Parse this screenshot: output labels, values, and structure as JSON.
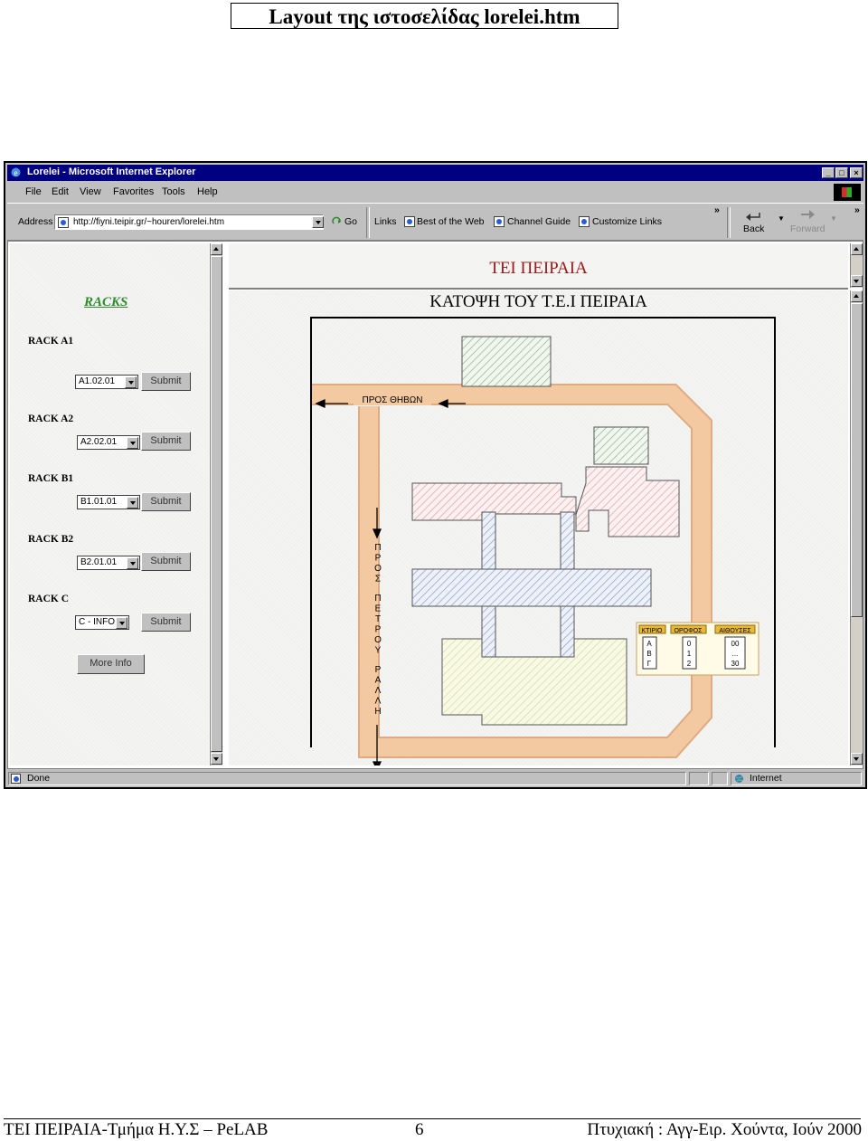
{
  "document": {
    "title": "Layout  της ιστοσελίδας  lorelei.htm",
    "footer": {
      "left": "ΤΕΙ ΠΕΙΡΑΙΑ-Τμήμα Η.Υ.Σ – PeLAB",
      "page": "6",
      "right": "Πτυχιακή : Αγγ-Ειρ. Χούντα, Ιούν 2000"
    }
  },
  "browser": {
    "window_title": "Lorelei - Microsoft Internet Explorer",
    "caption_buttons": [
      "_",
      "□",
      "×"
    ],
    "menu": [
      "File",
      "Edit",
      "View",
      "Favorites",
      "Tools",
      "Help"
    ],
    "address_label": "Address",
    "address_value": "http://fiyni.teipir.gr/~houren/lorelei.htm",
    "go_label": "Go",
    "links_label": "Links",
    "links": [
      "Best of the Web",
      "Channel Guide",
      "Customize Links"
    ],
    "chevron": "»",
    "back_label": "Back",
    "forward_label": "Forward",
    "status_text": "Done",
    "zone_text": "Internet"
  },
  "left_frame": {
    "heading": "RACKS",
    "racks": [
      {
        "label": "RACK A1",
        "select": "A1.02.01",
        "button": "Submit"
      },
      {
        "label": "RACK A2",
        "select": "A2.02.01",
        "button": "Submit"
      },
      {
        "label": "RACK B1",
        "select": "B1.01.01",
        "button": "Submit"
      },
      {
        "label": "RACK B2",
        "select": "B2.01.01",
        "button": "Submit"
      },
      {
        "label": "RACK C",
        "select": "C - INFO",
        "button": "Submit"
      }
    ],
    "more_info": "More Info"
  },
  "top_frame": {
    "title": "ΤΕΙ ΠΕΙΡΑΙΑ"
  },
  "main_frame": {
    "title": "ΚΑΤΟΨΗ ΤΟΥ Τ.Ε.Ι ΠΕΙΡΑΙΑ",
    "road_top": "ΠΡΟΣ ΘΗΒΩΝ",
    "road_left": "ΠΡΟΣ ΠΕΤΡΟΥ ΡΑΛΛΗ",
    "legend": {
      "headers": [
        "ΚΤΙΡΙΟ",
        "ΟΡΟΦΟΣ",
        "ΑΙΘΟΥΣΕΣ"
      ],
      "col1": [
        "Α",
        "Β",
        "Γ"
      ],
      "col2": [
        "0",
        "1",
        "2"
      ],
      "col3": [
        "00",
        "...",
        "30"
      ]
    }
  },
  "colors": {
    "title_bar": "#000080",
    "road": "#f3c9a1",
    "road_edge": "#e0ab80",
    "building_red": "#e4a3a3",
    "building_blue": "#8aa3d4",
    "building_green": "#8fb78f",
    "building_yellow": "#d9df9a",
    "tei_title": "#a01818",
    "racks_heading": "#2e8b2e"
  }
}
